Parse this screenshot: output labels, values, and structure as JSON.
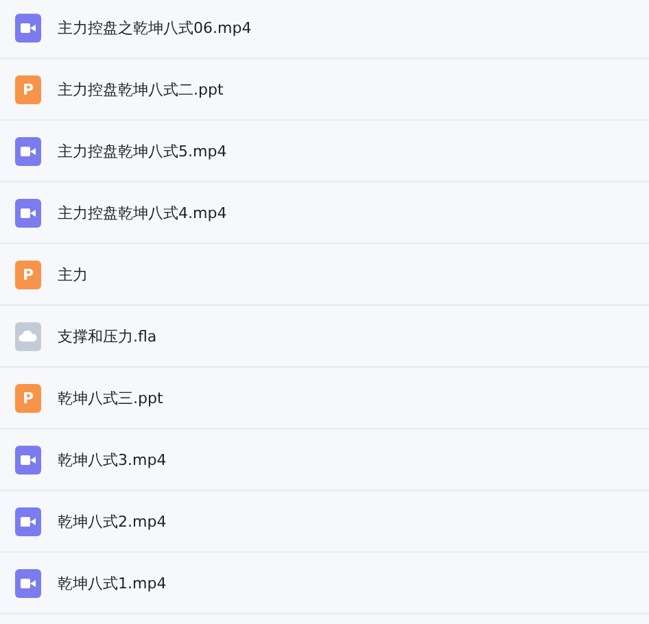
{
  "files": [
    {
      "kind": "video",
      "name": "主力控盘之乾坤八式06.mp4"
    },
    {
      "kind": "ppt",
      "icon_letter": "P",
      "name": "主力控盘乾坤八式二.ppt"
    },
    {
      "kind": "video",
      "name": "主力控盘乾坤八式5.mp4"
    },
    {
      "kind": "video",
      "name": "主力控盘乾坤八式4.mp4"
    },
    {
      "kind": "ppt",
      "icon_letter": "P",
      "name": "主力"
    },
    {
      "kind": "cloud",
      "name": "支撑和压力.fla"
    },
    {
      "kind": "ppt",
      "icon_letter": "P",
      "name": "乾坤八式三.ppt"
    },
    {
      "kind": "video",
      "name": "乾坤八式3.mp4"
    },
    {
      "kind": "video",
      "name": "乾坤八式2.mp4"
    },
    {
      "kind": "video",
      "name": "乾坤八式1.mp4"
    }
  ]
}
